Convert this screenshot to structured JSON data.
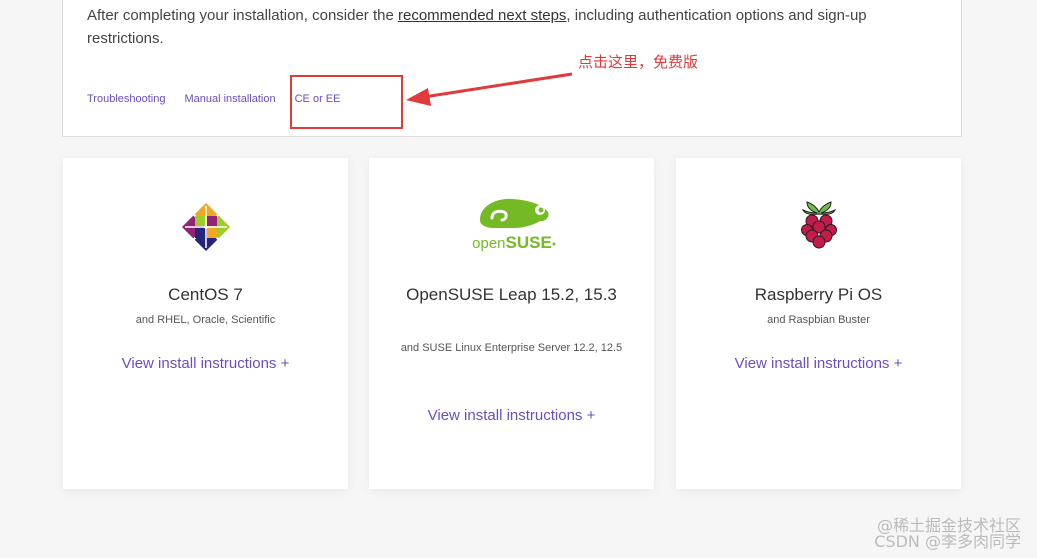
{
  "intro": {
    "before": "After completing your installation, consider the ",
    "link": "recommended next steps",
    "after": ", including authentication options and sign-up restrictions."
  },
  "links": [
    "Troubleshooting",
    "Manual installation",
    "CE or EE"
  ],
  "annotation": "点击这里，免费版",
  "cards": [
    {
      "title": "CentOS 7",
      "subtitle": "and RHEL, Oracle, Scientific",
      "cta": "View install instructions +"
    },
    {
      "title": "OpenSUSE Leap 15.2, 15.3",
      "subtitle": "and SUSE Linux Enterprise Server 12.2, 12.5",
      "cta": "View install instructions +"
    },
    {
      "title": "Raspberry Pi OS",
      "subtitle": "and Raspbian Buster",
      "cta": "View install instructions +"
    }
  ],
  "watermark": {
    "line1": "@稀土掘金技术社区",
    "line2": "CSDN @李多肉同学"
  },
  "colors": {
    "link_purple": "#6b4fbb",
    "annotation_red": "#e03a3a",
    "suse_green": "#73ba25"
  }
}
